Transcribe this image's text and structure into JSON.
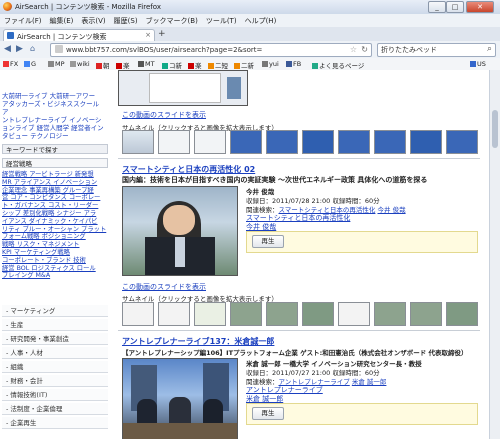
{
  "window": {
    "title": "AirSearch | コンテンツ検索 - Mozilla Firefox",
    "min": "_",
    "max": "□",
    "close": "✕"
  },
  "menu": [
    "ファイル(F)",
    "編集(E)",
    "表示(V)",
    "履歴(S)",
    "ブックマーク(B)",
    "ツール(T)",
    "ヘルプ(H)"
  ],
  "tab": {
    "label": "AirSearch | コンテンツ検索",
    "close": "×",
    "new": "+"
  },
  "nav": {
    "url": "www.bbt757.com/svlBOS/user/airsearch?page=2&sort=",
    "search": "折りたたみベッド"
  },
  "bookmarks": [
    "FX",
    "G",
    "MP",
    "wiki",
    "朝",
    "楽",
    "MT",
    "コ新",
    "楽",
    "二短",
    "二新",
    "yui",
    "FB",
    "よく見るページ",
    "US"
  ],
  "sidebar": {
    "pre_lines": [
      "大前研一ライブ  大前研一アワー",
      "アタッカーズ・ビジネススクール  ア",
      "ントレプレナーライブ  イノベーシ",
      "ョンライブ  経営人間学  経営者イン",
      "タビュー  テクノロジー"
    ],
    "keyword_label": "キーワードで探す",
    "category_label": "経営戦略",
    "keyword_lines": [
      "経営戦略  アービトラージ  新発想",
      "MR  アライアンス  イノベーション",
      "企業理念  事業再構築  グループ経",
      "営  コア・コンピタンス  コーポレー",
      "ト・ガバナンス  コスト・リーダー",
      "シップ  差別化戦略  シナジー  アラ",
      "イアンス  ダイナミック・ケイパビ",
      "リティ  ブルー・オーシャン  プラット",
      "フォーム戦略  ポジショニング",
      "戦略  リスク・マネジメント",
      "KPI  マーケティング戦略",
      "コーポレート・ブランド  技術",
      "経営  BOL  ロジスティクス  ロール",
      "プレイング  M&A"
    ],
    "categories": [
      "マーケティング",
      "生産",
      "研究開発・事業創造",
      "人事・人材",
      "組織",
      "財務・会計",
      "情報技術(IT)",
      "法制度・企業倫理",
      "企業再生"
    ]
  },
  "main": {
    "top": {
      "video_link": "この動画のスライドを表示",
      "thumb_label": "サムネイル（クリックすると画像を拡大表示します）"
    },
    "item1": {
      "title": "スマートシティと日本の再活性化 02",
      "subtitle": "国内編：技術を日本が目指すべき国内の実証実験 ～次世代エネルギー政策 具体化への道筋を探る",
      "speaker": "今井 俊哉",
      "record_date": "収録日：2011/07/28 21:00  収録時間：60分",
      "related_prefix": "関連検索：",
      "related_links": [
        "スマートシティと日本の再活性化",
        "今井 俊哉"
      ],
      "series_link": "スマートシティと日本の再活性化",
      "speaker_link": "今井 俊哉",
      "play": "再生",
      "video_link": "この動画のスライドを表示",
      "thumb_label": "サムネイル（クリックすると画像を拡大表示します）"
    },
    "item2": {
      "title": "アントレプレナーライブ137：米倉誠一郎",
      "subtitle": "【アントレプレナーシップ編106】ITプラットフォーム企業 ゲスト:和田憲治氏（株式会社オンザボード 代表取締役）",
      "speaker": "米倉 誠一郎 一橋大学 イノベーション研究センター長・教授",
      "record_date": "収録日：2011/07/27 21:00  収録時間：60分",
      "related_prefix": "関連検索：",
      "related_links": [
        "アントレプレナーライブ",
        "米倉 誠一郎"
      ],
      "series_link": "アントレプレナーライブ",
      "speaker_link": "米倉 誠一郎",
      "play": "再生"
    }
  },
  "colors": {
    "link": "#1a3fbf",
    "accent_bar": "#2e6cc4",
    "play_box": "#fffbe0"
  }
}
